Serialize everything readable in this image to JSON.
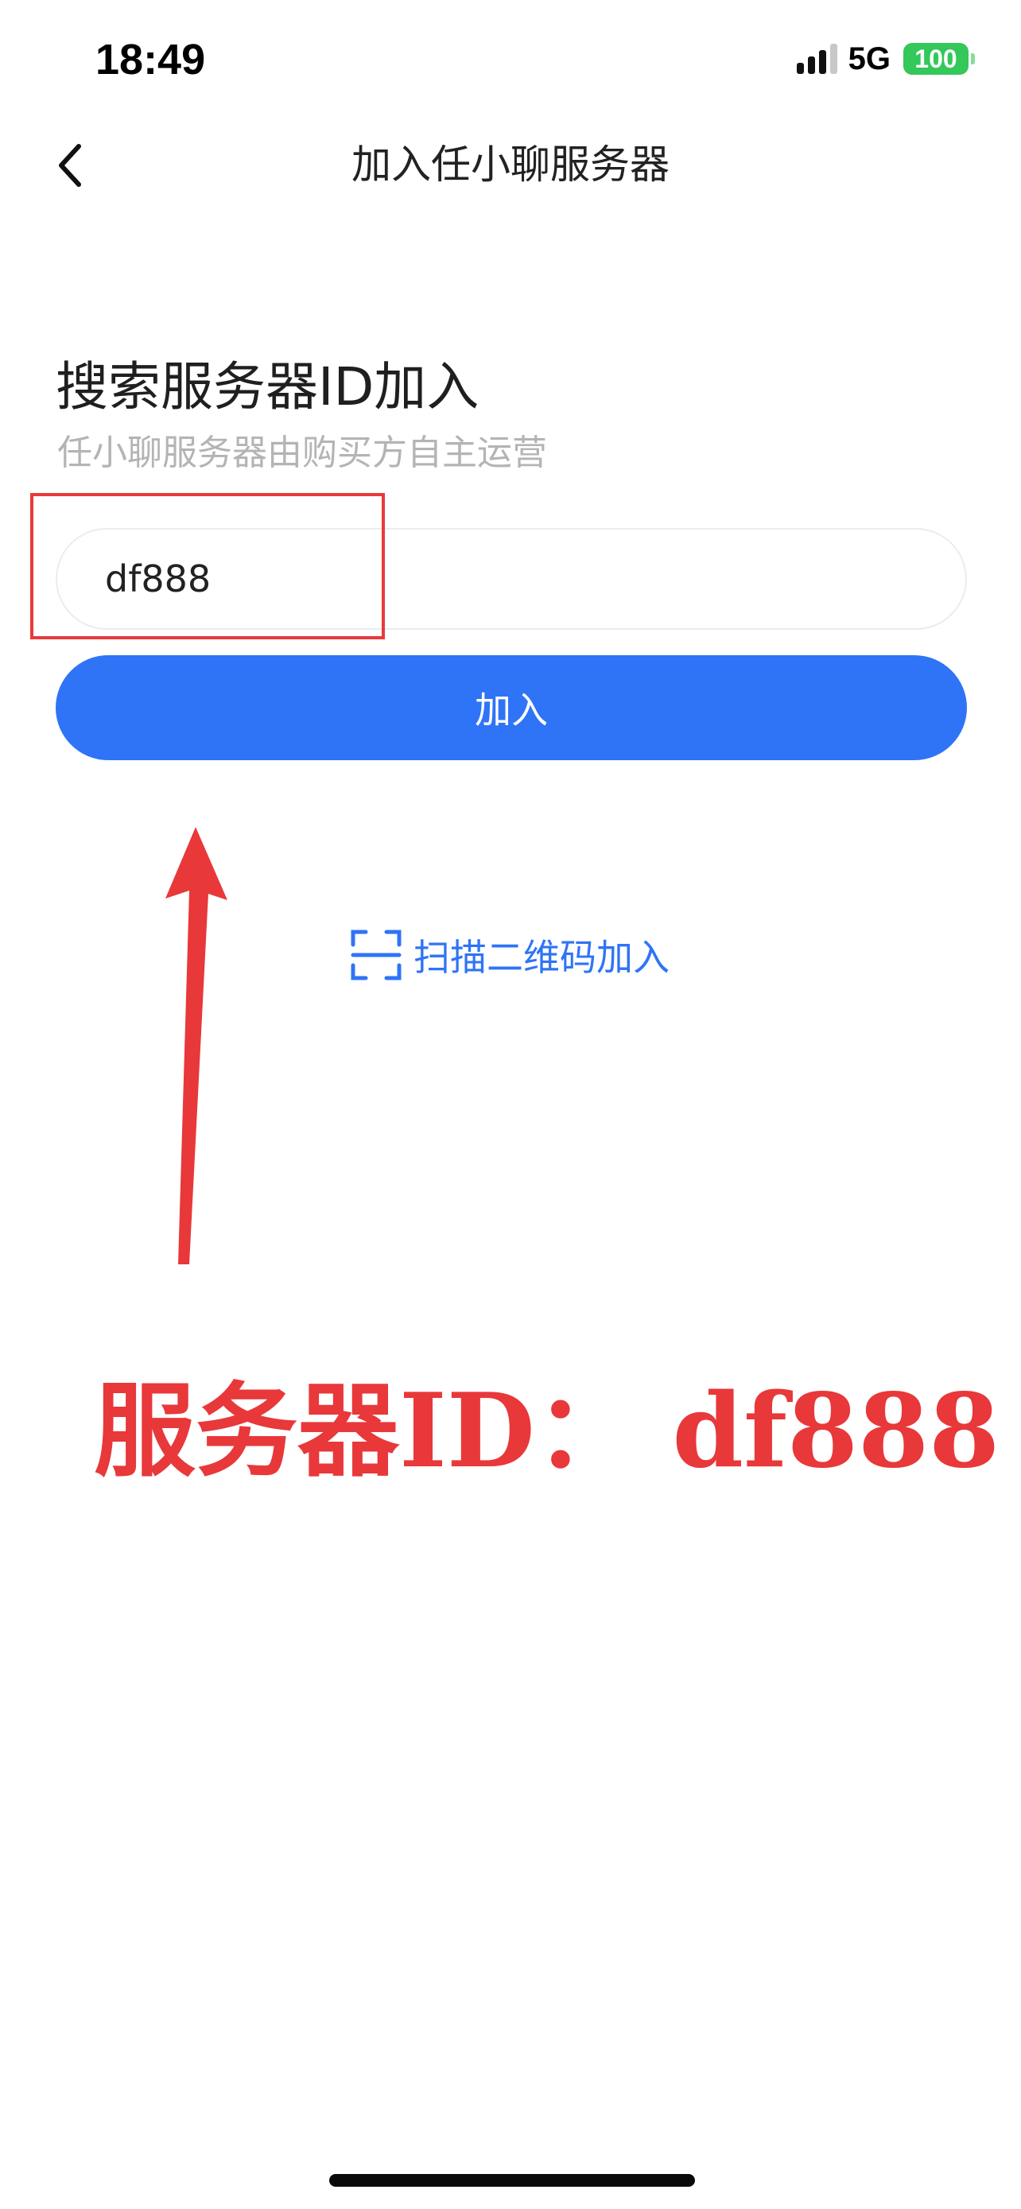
{
  "status_bar": {
    "time": "18:49",
    "network": "5G",
    "battery": "100"
  },
  "nav": {
    "back_icon": "chevron-left-icon",
    "title": "加入任小聊服务器"
  },
  "main": {
    "heading": "搜索服务器ID加入",
    "subheading": "任小聊服务器由购买方自主运营",
    "server_id_input": {
      "value": "df888",
      "placeholder": ""
    },
    "join_button_label": "加入",
    "scan_icon": "qr-scan-icon",
    "scan_label": "扫描二维码加入"
  },
  "annotation": {
    "text": "服务器ID： df888",
    "color": "#e8383a"
  },
  "colors": {
    "accent": "#2f74f6",
    "annotation": "#e8383a",
    "battery": "#34c759"
  }
}
